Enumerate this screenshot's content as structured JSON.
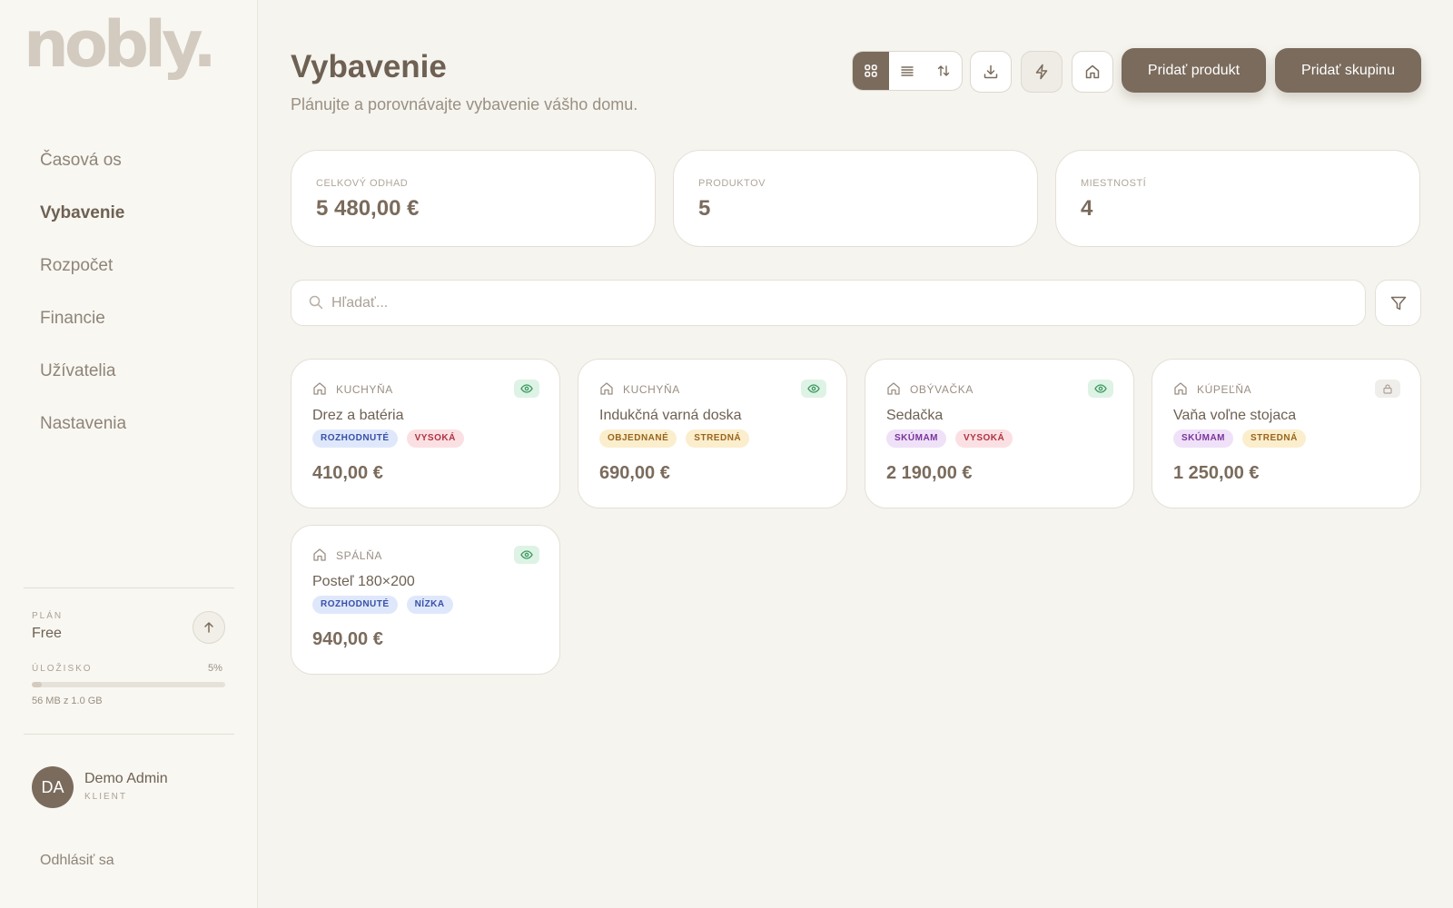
{
  "app": {
    "logo_text": "nobly."
  },
  "sidebar": {
    "nav": [
      {
        "label": "Časová os",
        "active": false
      },
      {
        "label": "Vybavenie",
        "active": true
      },
      {
        "label": "Rozpočet",
        "active": false
      },
      {
        "label": "Financie",
        "active": false
      },
      {
        "label": "Užívatelia",
        "active": false
      },
      {
        "label": "Nastavenia",
        "active": false
      }
    ],
    "plan": {
      "label": "PLÁN",
      "value": "Free",
      "upgrade_icon": "arrow-up-icon"
    },
    "storage": {
      "label": "ÚLOŽISKO",
      "percent_text": "5%",
      "fraction": 0.05,
      "usage_text": "56 MB z 1.0 GB"
    },
    "user": {
      "initials": "DA",
      "name": "Demo Admin",
      "role": "KLIENT"
    },
    "logout_label": "Odhlásiť sa"
  },
  "header": {
    "title": "Vybavenie",
    "subtitle": "Plánujte a porovnávajte vybavenie vášho domu.",
    "view_modes": [
      {
        "icon": "grid-icon",
        "active": true
      },
      {
        "icon": "list-icon",
        "active": false
      },
      {
        "icon": "sort-icon",
        "active": false
      }
    ],
    "actions": {
      "download_icon": "download-icon",
      "lightning_icon": "lightning-icon",
      "home_icon": "home-icon",
      "add_product_label": "Pridať produkt",
      "add_group_label": "Pridať skupinu"
    }
  },
  "stats": [
    {
      "label": "CELKOVÝ ODHAD",
      "value": "5 480,00 €"
    },
    {
      "label": "PRODUKTOV",
      "value": "5"
    },
    {
      "label": "MIESTNOSTÍ",
      "value": "4"
    }
  ],
  "search": {
    "placeholder": "Hľadať...",
    "value": ""
  },
  "products": [
    {
      "room": "KUCHYŇA",
      "name": "Drez a batéria",
      "status": "ROZHODNUTÉ",
      "status_key": "rozhodnute",
      "priority": "VYSOKÁ",
      "priority_key": "vysoka",
      "price": "410,00 €",
      "visibility_icon": "eye-icon"
    },
    {
      "room": "KUCHYŇA",
      "name": "Indukčná varná doska",
      "status": "OBJEDNANÉ",
      "status_key": "objednane",
      "priority": "STREDNÁ",
      "priority_key": "stredna",
      "price": "690,00 €",
      "visibility_icon": "eye-icon"
    },
    {
      "room": "OBÝVAČKA",
      "name": "Sedačka",
      "status": "SKÚMAM",
      "status_key": "skumam",
      "priority": "VYSOKÁ",
      "priority_key": "vysoka",
      "price": "2 190,00 €",
      "visibility_icon": "eye-icon"
    },
    {
      "room": "KÚPEĽŇA",
      "name": "Vaňa voľne stojaca",
      "status": "SKÚMAM",
      "status_key": "skumam",
      "priority": "STREDNÁ",
      "priority_key": "stredna",
      "price": "1 250,00 €",
      "visibility_icon": "lock-icon"
    },
    {
      "room": "SPÁLŇA",
      "name": "Posteľ 180×200",
      "status": "ROZHODNUTÉ",
      "status_key": "rozhodnute",
      "priority": "NÍZKA",
      "priority_key": "nizka",
      "price": "940,00 €",
      "visibility_icon": "eye-icon"
    }
  ],
  "colors": {
    "background": "#f5f4ee",
    "sidebar": "#f8f7f2",
    "accent": "#7a6b5c",
    "logo": "#d3cac0"
  }
}
